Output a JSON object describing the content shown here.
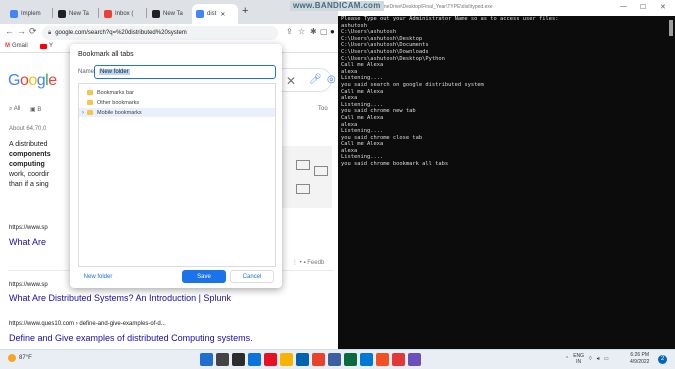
{
  "browser": {
    "tabs": [
      {
        "label": "Implem",
        "color": "#4285f4"
      },
      {
        "label": "New Ta",
        "color": "#202124"
      },
      {
        "label": "Inbox (",
        "color": "#ea4335"
      },
      {
        "label": "New Ta",
        "color": "#202124"
      },
      {
        "label": "dist",
        "color": "#4285f4",
        "active": true
      }
    ],
    "new_tab_glyph": "+",
    "url": "google.com/search?q=%20distributed%20system",
    "bookmarks": [
      {
        "label": "Gmail",
        "color": "#ea4335"
      },
      {
        "label": "Y",
        "color": "#ff0000"
      }
    ]
  },
  "search": {
    "logo": [
      {
        "ch": "G",
        "color": "#4285f4"
      },
      {
        "ch": "o",
        "color": "#ea4335"
      },
      {
        "ch": "o",
        "color": "#fbbc05"
      },
      {
        "ch": "g",
        "color": "#4285f4"
      },
      {
        "ch": "l",
        "color": "#34a853"
      },
      {
        "ch": "e",
        "color": "#ea4335"
      }
    ],
    "clear_glyph": "✕",
    "filters": {
      "all": "All",
      "images_initial": "B",
      "tools_initial": "Too"
    },
    "result_stats": "About 64,70,0",
    "snippet_lines": [
      "A distributed",
      "components",
      "computing",
      "work, coordir",
      "than if a sing"
    ],
    "results": [
      {
        "url": "https://www.sp",
        "title": "What Are"
      },
      {
        "url": "https://www.sp",
        "title": "What Are Distributed Systems? An Introduction | Splunk"
      },
      {
        "url": "https://www.ques10.com › define-and-give-examples-of-d...",
        "title": "Define and Give examples of distributed Computing systems."
      }
    ],
    "feedback": "Feedb"
  },
  "dialog": {
    "title": "Bookmark all tabs",
    "name_label": "Name",
    "name_value": "New folder",
    "folders": [
      {
        "label": "Bookmarks bar",
        "selected": false
      },
      {
        "label": "Other bookmarks",
        "selected": false
      },
      {
        "label": "Mobile bookmarks",
        "selected": true
      }
    ],
    "new_folder_label": "New folder",
    "save_label": "Save",
    "cancel_label": "Cancel"
  },
  "terminal": {
    "watermark": "www.BANDICAM.com",
    "path": "OneDrive\\Desktop\\Final_Year\\TYPE\\dist\\typed.exe",
    "lines": [
      "Please Type out your Administrator Name so as to access user files:",
      "ashutosh",
      "C:\\Users\\ashutosh",
      "C:\\Users\\ashutosh\\Desktop",
      "C:\\Users\\ashutosh\\Documents",
      "C:\\Users\\ashutosh\\Downloads",
      "C:\\Users\\ashutosh\\Desktop\\Python",
      "Call me Alexa",
      "alexa",
      "Listening....",
      "you said search on google distributed system",
      "Call me Alexa",
      "alexa",
      "Listening....",
      "you said chrome new tab",
      "Call me Alexa",
      "alexa",
      "Listening....",
      "you said chrome close tab",
      "Call me Alexa",
      "alexa",
      "Listening....",
      "you said chrome bookmark all tabs"
    ]
  },
  "taskbar": {
    "weather": "87°F",
    "apps": [
      "#1f6fd1",
      "#444444",
      "#2d2d2d",
      "#0a74da",
      "#e81123",
      "#f8b400",
      "#0063b1",
      "#e8412c",
      "#3b5fa0",
      "#0b6a3f",
      "#0078d4",
      "#f25022",
      "#e23838",
      "#6b4fbb"
    ],
    "tray_lang": "ENG",
    "tray_region": "IN",
    "time": "6:26 PM",
    "date": "4/9/2022",
    "notif_count": "2"
  }
}
